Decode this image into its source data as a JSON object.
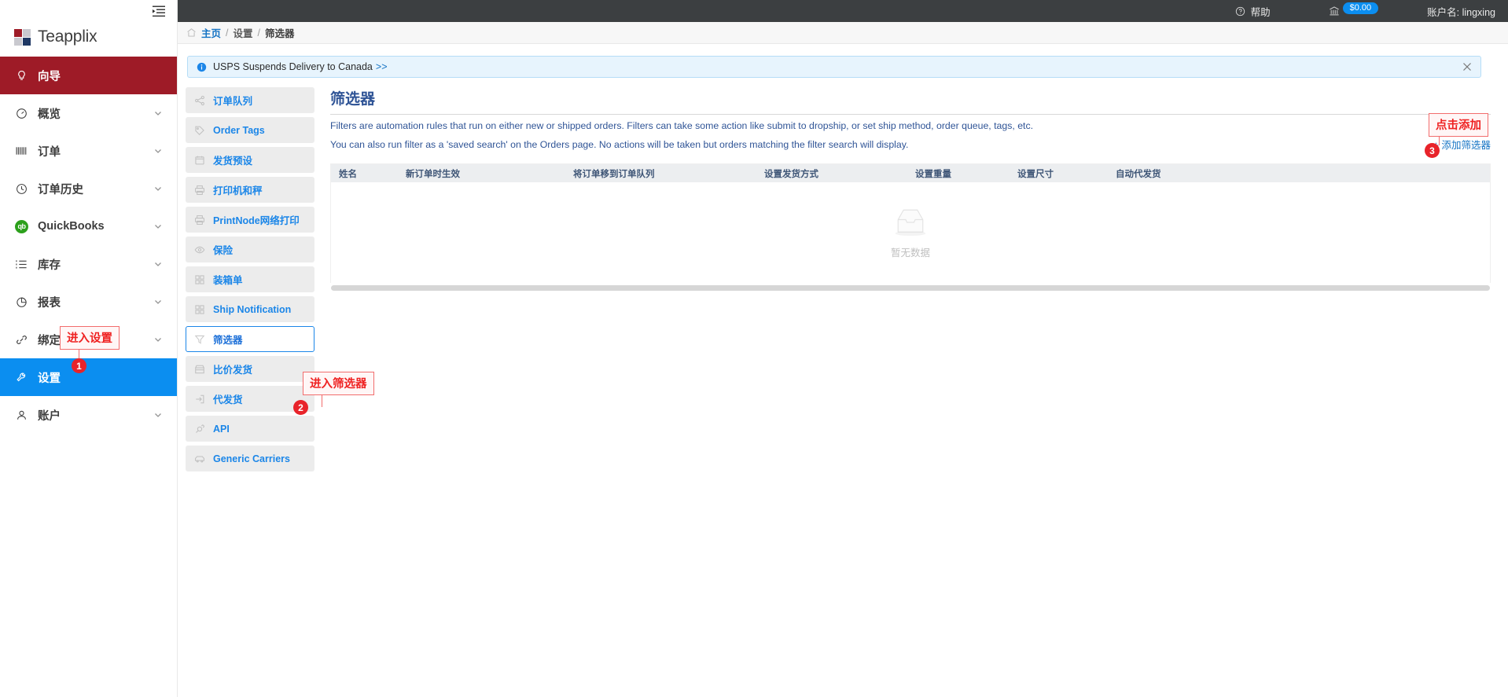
{
  "topbar": {
    "help_label": "帮助",
    "help_icon": "question-circle-icon",
    "wallet_icon": "bank-icon",
    "balance": "$0.00",
    "account_label": "账户名: lingxing"
  },
  "sidebar": {
    "collapse_icon": "collapse-menu-icon",
    "brand": "Teapplix",
    "items": [
      {
        "label": "向导",
        "icon": "lightbulb-icon",
        "state": "active-red",
        "chevron": false
      },
      {
        "label": "概览",
        "icon": "gauge-icon",
        "state": "normal",
        "chevron": true
      },
      {
        "label": "订单",
        "icon": "barcode-icon",
        "state": "normal",
        "chevron": true
      },
      {
        "label": "订单历史",
        "icon": "clock-icon",
        "state": "normal",
        "chevron": true
      },
      {
        "label": "QuickBooks",
        "icon": "quickbooks-icon",
        "state": "normal",
        "chevron": true
      },
      {
        "label": "库存",
        "icon": "list-icon",
        "state": "normal",
        "chevron": true
      },
      {
        "label": "报表",
        "icon": "pie-chart-icon",
        "state": "normal",
        "chevron": true
      },
      {
        "label": "绑定",
        "icon": "link-icon",
        "state": "normal",
        "chevron": true
      },
      {
        "label": "设置",
        "icon": "wrench-icon",
        "state": "active-blue",
        "chevron": false
      },
      {
        "label": "账户",
        "icon": "user-icon",
        "state": "normal",
        "chevron": true
      }
    ]
  },
  "breadcrumb": {
    "home_icon": "home-icon",
    "home": "主页",
    "sep": "/",
    "middle": "设置",
    "current": "筛选器"
  },
  "alert": {
    "icon": "info-circle-icon",
    "text": "USPS Suspends Delivery to Canada",
    "arrows": ">>",
    "close_icon": "close-icon"
  },
  "submenu": {
    "items": [
      {
        "label": "订单队列",
        "icon": "share-nodes-icon",
        "selected": false
      },
      {
        "label": "Order Tags",
        "icon": "tag-icon",
        "selected": false
      },
      {
        "label": "发货预设",
        "icon": "calendar-a-icon",
        "selected": false
      },
      {
        "label": "打印机和秤",
        "icon": "printer-icon",
        "selected": false
      },
      {
        "label": "PrintNode网络打印",
        "icon": "printer-icon",
        "selected": false
      },
      {
        "label": "保险",
        "icon": "eye-icon",
        "selected": false
      },
      {
        "label": "装箱单",
        "icon": "grid-icon",
        "selected": false
      },
      {
        "label": "Ship Notification",
        "icon": "grid-icon",
        "selected": false
      },
      {
        "label": "筛选器",
        "icon": "funnel-icon",
        "selected": true
      },
      {
        "label": "比价发货",
        "icon": "store-icon",
        "selected": false
      },
      {
        "label": "代发货",
        "icon": "export-icon",
        "selected": false
      },
      {
        "label": "API",
        "icon": "plug-icon",
        "selected": false
      },
      {
        "label": "Generic Carriers",
        "icon": "truck-icon",
        "selected": false
      }
    ]
  },
  "main": {
    "title": "筛选器",
    "desc_line1": "Filters are automation rules that run on either new or shipped orders. Filters can take some action like submit to dropship, or set ship method, order queue, tags, etc.",
    "desc_line2": "You can also run filter as a 'saved search' on the Orders page. No actions will be taken but orders matching the filter search will display.",
    "add_link": "+ 添加筛选器",
    "table": {
      "columns": [
        "姓名",
        "新订单时生效",
        "将订单移到订单队列",
        "设置发货方式",
        "设置重量",
        "设置尺寸",
        "自动代发货"
      ],
      "rows": [],
      "empty_icon": "empty-inbox-icon",
      "empty_text": "暂无数据"
    }
  },
  "annotations": [
    {
      "label": "进入设置",
      "badge": "1"
    },
    {
      "label": "进入筛选器",
      "badge": "2"
    },
    {
      "label": "点击添加",
      "badge": "3"
    }
  ],
  "colors": {
    "brand_red": "#9e1b27",
    "accent_blue": "#0b8ef0",
    "link_blue": "#1473c4",
    "title_blue": "#2f5496",
    "annotation_red": "#ef2222",
    "topbar_dark": "#3c3f41"
  }
}
